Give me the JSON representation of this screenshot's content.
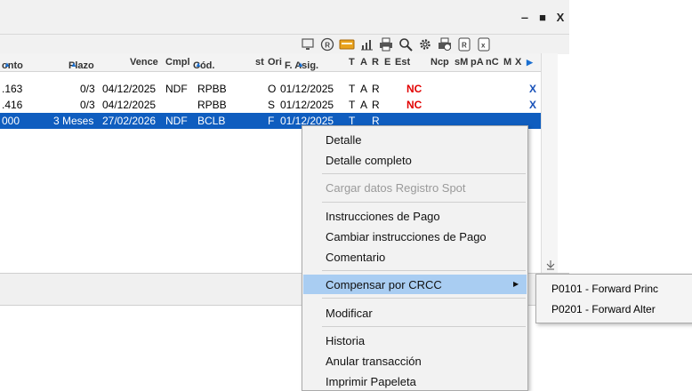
{
  "window": {
    "minimize": "‒",
    "maximize": "■",
    "close": "X"
  },
  "toolbar_icons": [
    "monitor-icon",
    "r-circle-icon",
    "card-icon",
    "chart-icon",
    "printer-icon",
    "search-icon",
    "gear-icon",
    "print-b-icon",
    "r-box-icon",
    "x-box-icon"
  ],
  "grid": {
    "headers": {
      "monto": "onto",
      "plazo": "Plazo",
      "vence": "Vence",
      "cmpl": "Cmpl",
      "cod": "Cód.",
      "st": "st",
      "ori": "Ori",
      "fasig": "F. Asig.",
      "t": "T",
      "a": "A",
      "r": "R",
      "e": "E",
      "est": "Est",
      "ncp": "Ncp",
      "sm": "sM",
      "pa": "pA",
      "nc": "nC",
      "m": "M",
      "x": "X",
      "scroll": "▶"
    },
    "rows": [
      {
        "monto": ".163",
        "plazo": "0/3",
        "vence": "04/12/2025",
        "cmpl": "NDF",
        "cod": "RPBB",
        "ori": "O",
        "fasig": "01/12/2025",
        "t": "T",
        "a": "A",
        "r": "R",
        "est": "NC",
        "x": "X"
      },
      {
        "monto": ".416",
        "plazo": "0/3",
        "vence": "04/12/2025",
        "cmpl": "",
        "cod": "RPBB",
        "ori": "S",
        "fasig": "01/12/2025",
        "t": "T",
        "a": "A",
        "r": "R",
        "est": "NC",
        "x": "X"
      },
      {
        "monto": "000",
        "plazo": "3 Meses",
        "vence": "27/02/2026",
        "cmpl": "NDF",
        "cod": "BCLB",
        "ori": "F",
        "fasig": "01/12/2025",
        "t": "T",
        "a": "",
        "r": "R",
        "est": "",
        "x": ""
      }
    ]
  },
  "context_menu": {
    "detalle": "Detalle",
    "detalle_completo": "Detalle completo",
    "cargar_datos": "Cargar datos Registro Spot",
    "instrucciones": "Instrucciones de Pago",
    "cambiar_instrucciones": "Cambiar instrucciones de Pago",
    "comentario": "Comentario",
    "compensar": "Compensar por CRCC",
    "submenu_arrow": "▶",
    "modificar": "Modificar",
    "historia": "Historia",
    "anular": "Anular transacción",
    "imprimir": "Imprimir Papeleta"
  },
  "submenu": {
    "item1": "P0101 - Forward Princ",
    "item2": "P0201 - Forward Alter"
  }
}
